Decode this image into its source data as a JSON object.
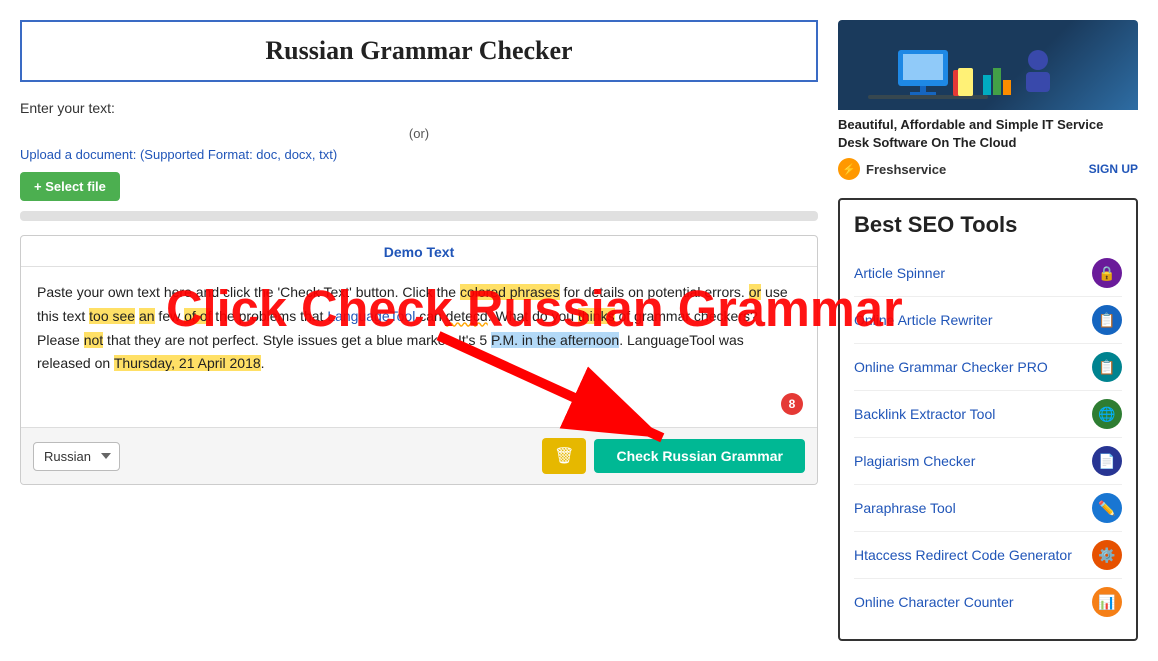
{
  "header": {
    "title": "Russian Grammar Checker"
  },
  "form": {
    "enter_text_label": "Enter your text:",
    "or_label": "(or)",
    "upload_label": "Upload a document: (Supported Format: doc, docx, txt)",
    "select_file_btn": "+ Select file",
    "demo_text_header": "Demo Text",
    "demo_text": "Paste your own text here and click the 'Check Text' button. Click the colored phrases for details on potential errors.",
    "language_default": "Russian",
    "trash_icon": "🗑",
    "check_btn": "Check Russian Grammar",
    "badge": "8"
  },
  "overlay": {
    "text": "Click Check Russian Grammar"
  },
  "sidebar": {
    "ad_caption": "Beautiful, Affordable and Simple IT Service Desk Software On The Cloud",
    "brand_name": "Freshservice",
    "signup_text": "SIGN UP",
    "seo_title": "Best SEO Tools",
    "tools": [
      {
        "name": "Article Spinner",
        "icon_class": "icon-purple",
        "icon": "🔒"
      },
      {
        "name": "Online Article Rewriter",
        "icon_class": "icon-blue",
        "icon": "📋"
      },
      {
        "name": "Online Grammar Checker PRO",
        "icon_class": "icon-teal",
        "icon": "📋"
      },
      {
        "name": "Backlink Extractor Tool",
        "icon_class": "icon-green-dark",
        "icon": "🌐"
      },
      {
        "name": "Plagiarism Checker",
        "icon_class": "icon-indigo",
        "icon": "📄"
      },
      {
        "name": "Paraphrase Tool",
        "icon_class": "icon-blue2",
        "icon": "✏️"
      },
      {
        "name": "Htaccess Redirect Code Generator",
        "icon_class": "icon-orange",
        "icon": "⚙️"
      },
      {
        "name": "Online Character Counter",
        "icon_class": "icon-amber",
        "icon": "📊"
      }
    ]
  }
}
